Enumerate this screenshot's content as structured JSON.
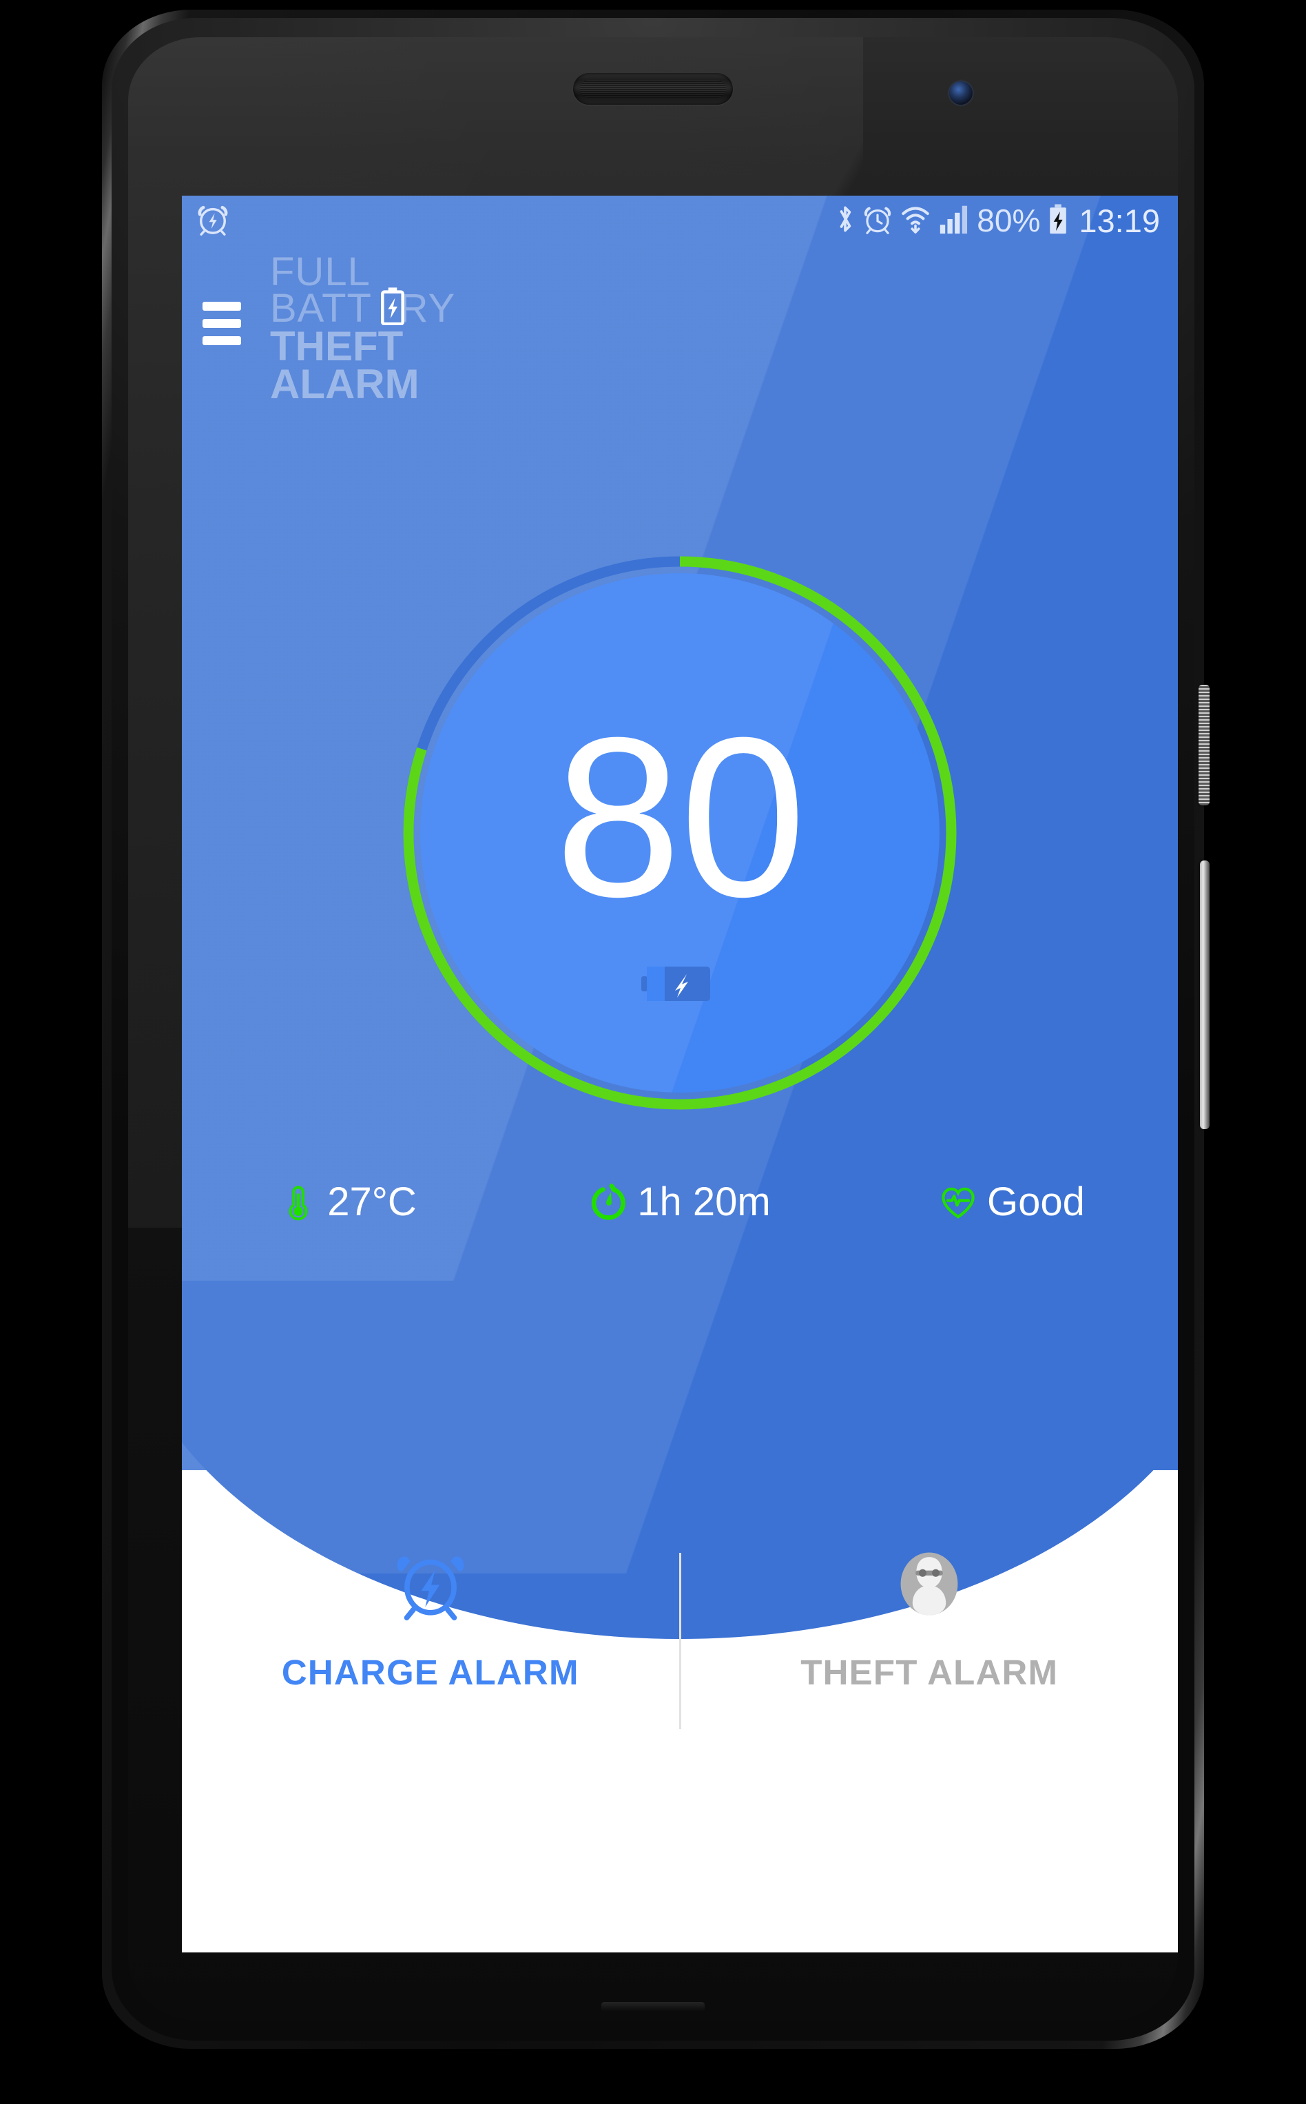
{
  "device": {
    "earpiece": "earpiece-speaker",
    "front_camera": "front-camera",
    "power_button": "power-button",
    "volume_button": "volume-rocker",
    "bottom_speaker": "bottom-speaker"
  },
  "status_bar": {
    "left_icons": [
      {
        "name": "alarm-charge-icon",
        "label": "charge alarm active"
      }
    ],
    "right_icons": [
      {
        "name": "bluetooth-icon",
        "label": "Bluetooth"
      },
      {
        "name": "alarm-clock-icon",
        "label": "Alarm set"
      },
      {
        "name": "wifi-icon",
        "label": "Wi-Fi"
      },
      {
        "name": "signal-bars-icon",
        "label": "Cellular signal"
      },
      {
        "name": "battery-charging-icon",
        "label": "Battery charging"
      }
    ],
    "battery_percent": "80%",
    "time": "13:19"
  },
  "app_bar": {
    "menu_icon": "hamburger-menu-icon",
    "logo": {
      "line1": "FULL",
      "line2_before": "BATT",
      "line2_icon": "battery-bolt-icon",
      "line2_after": "RY",
      "line3": "THEFT",
      "line4": "ALARM"
    }
  },
  "gauge": {
    "value": "80",
    "unit_suffix": "",
    "percent": 80,
    "center_icon": "battery-charging-horizontal-icon",
    "arc_color": "#5CD718",
    "track_color": "#3b72d4",
    "fill_color": "#4285f4"
  },
  "stats": [
    {
      "icon": "thermometer-icon",
      "value": "27°C",
      "name": "temperature-stat"
    },
    {
      "icon": "timer-icon",
      "value": "1h 20m",
      "name": "time-remaining-stat"
    },
    {
      "icon": "heart-pulse-icon",
      "value": "Good",
      "name": "battery-health-stat"
    }
  ],
  "actions": [
    {
      "icon": "alarm-clock-bolt-icon",
      "label": "CHARGE ALARM",
      "state": "active",
      "color": "#4285f4"
    },
    {
      "icon": "thief-avatar-icon",
      "label": "THEFT ALARM",
      "state": "inactive",
      "color": "#b0b0b0"
    }
  ],
  "colors": {
    "header_blue": "#3b72d4",
    "header_blue_light": "#5484dc",
    "circle_blue": "#4285f4",
    "accent_green": "#5CD718",
    "screen_white": "#ffffff",
    "status_text": "#dbe6fb"
  }
}
